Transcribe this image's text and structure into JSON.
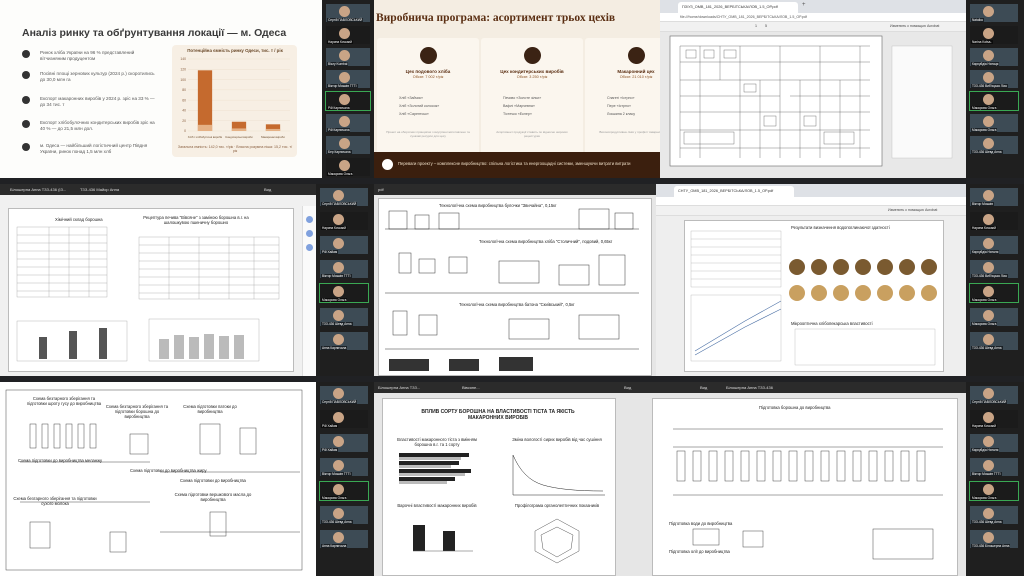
{
  "t1": {
    "title": "Аналіз ринку та обґрунтування локації — м. Одеса",
    "bullets": [
      "Ринок хліба України на 96 % представлений вітчизняним продуцентом",
      "Посівні площі зернових культур (2024 р.) скоротились до 30,0 млн га",
      "Експорт макаронних виробів у 2024 р. зріс на 33 % — до 34 тис. т",
      "Експорт хлібобулочних кондитерських виробів зріс на 40 % — до 21,5 млн дол.",
      "м. Одеса — найбільший логістичний центр Півдня України, ринок понад 1,5 млн хлб"
    ],
    "chart_title": "Потенційна ємність ринку Одеси, тис. т / рік",
    "chart_footnote": "Загальна ємність: 142,0 тис. т/рік · Власна розумна ніша: 15,2 тис. т/рік"
  },
  "chart_data": {
    "type": "bar",
    "title": "Потенційна ємність ринку Одеси, тис. т / рік",
    "categories": [
      "Хліб і хлібобулочні вироби",
      "Кондитерські вироби",
      "Макаронні вироби"
    ],
    "series": [
      {
        "values": [
          118,
          18,
          13
        ]
      },
      {
        "values": [
          12,
          5,
          4
        ]
      }
    ],
    "ylim": [
      0,
      140
    ],
    "yticks": [
      "140",
      "120",
      "100",
      "80",
      "60",
      "40",
      "20",
      "0"
    ],
    "colors": [
      "#c56a2e",
      "#e8b98f"
    ]
  },
  "strip1": {
    "participants": [
      "Сергій ПАВЛОВСЬКИЙ",
      "Нарина Кочкаєй",
      "Bizzy Kumbal",
      "Віктор Мошків TTTI",
      "Рій Карпичала",
      "Рій Карпичала",
      "Бер Карпичала",
      "Макарова Ольга"
    ]
  },
  "t2": {
    "title": "Виробнича програма: асортимент трьох цехів",
    "cards": [
      {
        "name": "Цех подового хліба",
        "volume": "Обсяг: 7 002 т/рік",
        "items": [
          "Хліб «Зайчик»",
          "Хліб «Золотий колосок»",
          "Хліб «Сарептськ»"
        ],
        "desc": "Проект на оборотних принципах з внутрішні жиготовлено та сушкові ресурси для цеху"
      },
      {
        "name": "Цех кондитерських виробів",
        "volume": "Обсяг: 3 250 т/рік",
        "items": [
          "Печиво «Золоте зільє»",
          "Вафлі «Марчевна»",
          "Тістечко «Еклер»"
        ],
        "desc": "Асортимент продукції ставить по відносно широких рецептурах"
      },
      {
        "name": "Макаронний цех",
        "volume": "Обсяг: 21 010 т/рік",
        "items": [
          "Спагеті «Істрпо»",
          "Пере «Істрпо»",
          "Локшина 2 класу"
        ],
        "desc": "Високопродуктивна лінія у профілі товарних виробів"
      }
    ],
    "footer": "Переваги проекту – комплексне виробництво: спільна логістика та енергоощадні системи, зменшуючи витрати витрати"
  },
  "t3": {
    "tab": "ПЗ/УЗ_ОМВ_181_2026_ВЕРБІТСЬКА/ЛОВ_1.5_ОР.pdf",
    "url": "file:///home/downloads/СНТУ_ОМВ_181_2026_ВЕРБІТСЬКА/ЛОВ_1.5_ОР.pdf",
    "page": "1",
    "pages": "5",
    "annotate": "Изменить с помощью Acrobat"
  },
  "strip3": {
    "participants": [
      "Віктор Мошків",
      "Нарина Кочкаєй",
      "Кархуйдіа Наталя",
      "ТЗЗ-436 Виб'яцька Ліза",
      "Макарова Ольга",
      "Макарова Ольга",
      "ТЗЗ-436 Шевд Анна"
    ]
  },
  "t4": {
    "tab1": "Білошерна Анна ТЗЗ-436 (ІЗ...",
    "tab2": "ТЗЗ-436 Майор Анна",
    "menu": "Вид",
    "title1": "Хімічний склад борошна",
    "title2": "Рецептура печива \"Вівсяне\" з заміною борошна в.г. на шалошкувою пшеничну борошно",
    "t3": "Шкала органолептичних оцінок (стандарт)",
    "t4": "Вміст органолептичних показників"
  },
  "strip4": {
    "participants": [
      "Сергій ПАВЛОВСЬКИЙ",
      "Нарина Кочкаєй",
      "Рій Хайам",
      "Віктор Мошків TTTI",
      "Макарова Ольга",
      "ТЗЗ-436 Шевд Анна",
      "Анна Карпичала"
    ]
  },
  "t5": {
    "tab": "pdf",
    "title1": "Технологічна схема виробництва булочки \"Звичайна\", 0,15кг",
    "title2": "Технологічна схема виробництва хліба \"Столичний\", подовий, 0,65кг",
    "title3": "Технологічна схема виробництва батона \"Скиівський\", 0,5кг"
  },
  "t6": {
    "tab": "СНТУ_ОМВ_181_2026_ВЕРБІТСЬКА/ЛОВ_1.5_ОР.pdf",
    "annotate": "Изменить с помощью Acrobat",
    "title": "Результати визначення водопоглинаючої здатності",
    "sub": "Мікрооптична хлібопекарська властивості"
  },
  "t7": {
    "label1": "Схема безтарного зберігання та підготовки шроту гусу до виробництва",
    "label2": "Схема безтарного зберігання та підготовки борошна до виробництва",
    "label3": "Схема підготовки патоки до виробництва",
    "label4": "Схема підготовки до виробництва меланжу",
    "label5": "Схема підготовки до виробництва жиру",
    "label6": "Схема безтарного зберігання та підготовки сухого молока",
    "label7": "Схема підготовки вершкового масла до виробництва",
    "label8": "Схема підготовки до виробництва"
  },
  "strip7": {
    "participants": [
      "Сергій ПАВЛОВСЬКИЙ",
      "Рій Хайам",
      "Рій Хайам",
      "Віктор Мошків TTTI",
      "Макарова Ольга",
      "ТЗЗ-436 Шевд Анна",
      "Анна Карпичала"
    ]
  },
  "t8": {
    "tab1": "Білошерна Анна ТЗЗ...",
    "tab2": "Вівсяне...",
    "menu": "Вид",
    "title": "ВПЛИВ СОРТУ БОРОШНА НА ВЛАСТИВОСТІ ТІСТА ТА ЯКІСТЬ МАКАРОННИХ ВИРОБІВ",
    "c1": "Властивості макаронного тіста з вмінням борошна в.г. та 1 сорту",
    "c2": "Зміна вологості сирих виробів від час сушіння",
    "c3": "Варочні властивості макаронних виробів",
    "c4": "Профілограма органолептичних показників"
  },
  "t9": {
    "tab": "Білошерна Анна ТЗЗ-436",
    "menu": "Вид",
    "title1": "Підготовка борошна до виробництва",
    "title2": "Підготовка води до виробництва",
    "title3": "Підготовка олії до виробництва"
  },
  "strip9": {
    "participants": [
      "Сергій ПАВЛОВСЬКИЙ",
      "Нарина Кочкаєй",
      "Кархуйдіа Наталя",
      "Віктор Мошків TTTI",
      "Макарова Ольга",
      "ТЗЗ-436 Шевд Анна",
      "ТЗЗ-436 Білошерна Анна"
    ]
  },
  "strip_top_right": {
    "participants": [
      "Natalka",
      "Narina Kotsa..",
      "Кархуйдіа Натаця",
      "ТЗЗ-436 Виб'яцька Ліза",
      "Макарова Ольга",
      "Макарова Ольга",
      "ТЗЗ-436 Шевд Анна"
    ]
  }
}
